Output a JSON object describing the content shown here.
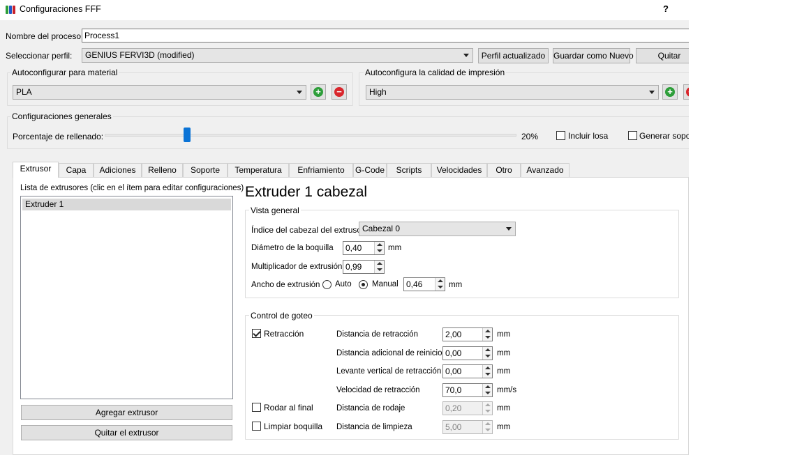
{
  "window": {
    "title": "Configuraciones FFF",
    "help_label": "?"
  },
  "process": {
    "name_label": "Nombre del proceso:",
    "name_value": "Process1"
  },
  "profile": {
    "label": "Seleccionar perfil:",
    "selected": "GENIUS FERVI3D (modified)",
    "update_button": "Perfil actualizado",
    "save_new_button": "Guardar como Nuevo",
    "remove_button": "Quitar"
  },
  "material": {
    "group_title": "Autoconfigurar para material",
    "selected": "PLA"
  },
  "quality": {
    "group_title": "Autoconfigura la calidad de impresión",
    "selected": "High"
  },
  "general": {
    "group_title": "Configuraciones generales",
    "infill_label": "Porcentaje de rellenado:",
    "infill_value_text": "20%",
    "infill_fraction": 0.2,
    "raft_label": "Incluir losa",
    "raft_checked": false,
    "support_label": "Generar sopor",
    "support_checked": false
  },
  "tabs": [
    {
      "label": "Extrusor",
      "active": true
    },
    {
      "label": "Capa",
      "active": false
    },
    {
      "label": "Adiciones",
      "active": false
    },
    {
      "label": "Relleno",
      "active": false
    },
    {
      "label": "Soporte",
      "active": false
    },
    {
      "label": "Temperatura",
      "active": false
    },
    {
      "label": "Enfriamiento",
      "active": false
    },
    {
      "label": "G-Code",
      "active": false
    },
    {
      "label": "Scripts",
      "active": false
    },
    {
      "label": "Velocidades",
      "active": false
    },
    {
      "label": "Otro",
      "active": false
    },
    {
      "label": "Avanzado",
      "active": false
    }
  ],
  "extruder_list": {
    "label": "Lista de extrusores (clic en el ítem para editar configuraciones)",
    "items": [
      "Extruder 1"
    ],
    "add_button": "Agregar extrusor",
    "remove_button": "Quitar el extrusor"
  },
  "extruder_detail": {
    "heading": "Extruder 1 cabezal",
    "overview": {
      "group_title": "Vista general",
      "nozzle_index_label": "Índice del cabezal del extrusor",
      "nozzle_index_value": "Cabezal 0",
      "nozzle_diameter_label": "Diámetro de la boquilla",
      "nozzle_diameter_value": "0,40",
      "nozzle_diameter_unit": "mm",
      "extrusion_multiplier_label": "Multiplicador de extrusión",
      "extrusion_multiplier_value": "0,99",
      "extrusion_width_label": "Ancho de extrusión",
      "extrusion_width_auto_label": "Auto",
      "extrusion_width_manual_label": "Manual",
      "extrusion_width_mode": "Manual",
      "extrusion_width_value": "0,46",
      "extrusion_width_unit": "mm"
    },
    "ooze": {
      "group_title": "Control de goteo",
      "retraction_label": "Retracción",
      "retraction_checked": true,
      "coast_label": "Rodar al final",
      "coast_checked": false,
      "wipe_label": "Limpiar boquilla",
      "wipe_checked": false,
      "rows": [
        {
          "label": "Distancia de retracción",
          "value": "2,00",
          "unit": "mm",
          "enabled": true
        },
        {
          "label": "Distancia adicional de reinicio",
          "value": "0,00",
          "unit": "mm",
          "enabled": true
        },
        {
          "label": "Levante vertical de retracción",
          "value": "0,00",
          "unit": "mm",
          "enabled": true
        },
        {
          "label": "Velocidad de retracción",
          "value": "70,0",
          "unit": "mm/s",
          "enabled": true
        },
        {
          "label": "Distancia de rodaje",
          "value": "0,20",
          "unit": "mm",
          "enabled": false
        },
        {
          "label": "Distancia de limpieza",
          "value": "5,00",
          "unit": "mm",
          "enabled": false
        }
      ]
    }
  },
  "colors": {
    "slider_handle": "#0a73d6",
    "add_icon": "#2e9e3a",
    "remove_icon": "#d9262c"
  }
}
